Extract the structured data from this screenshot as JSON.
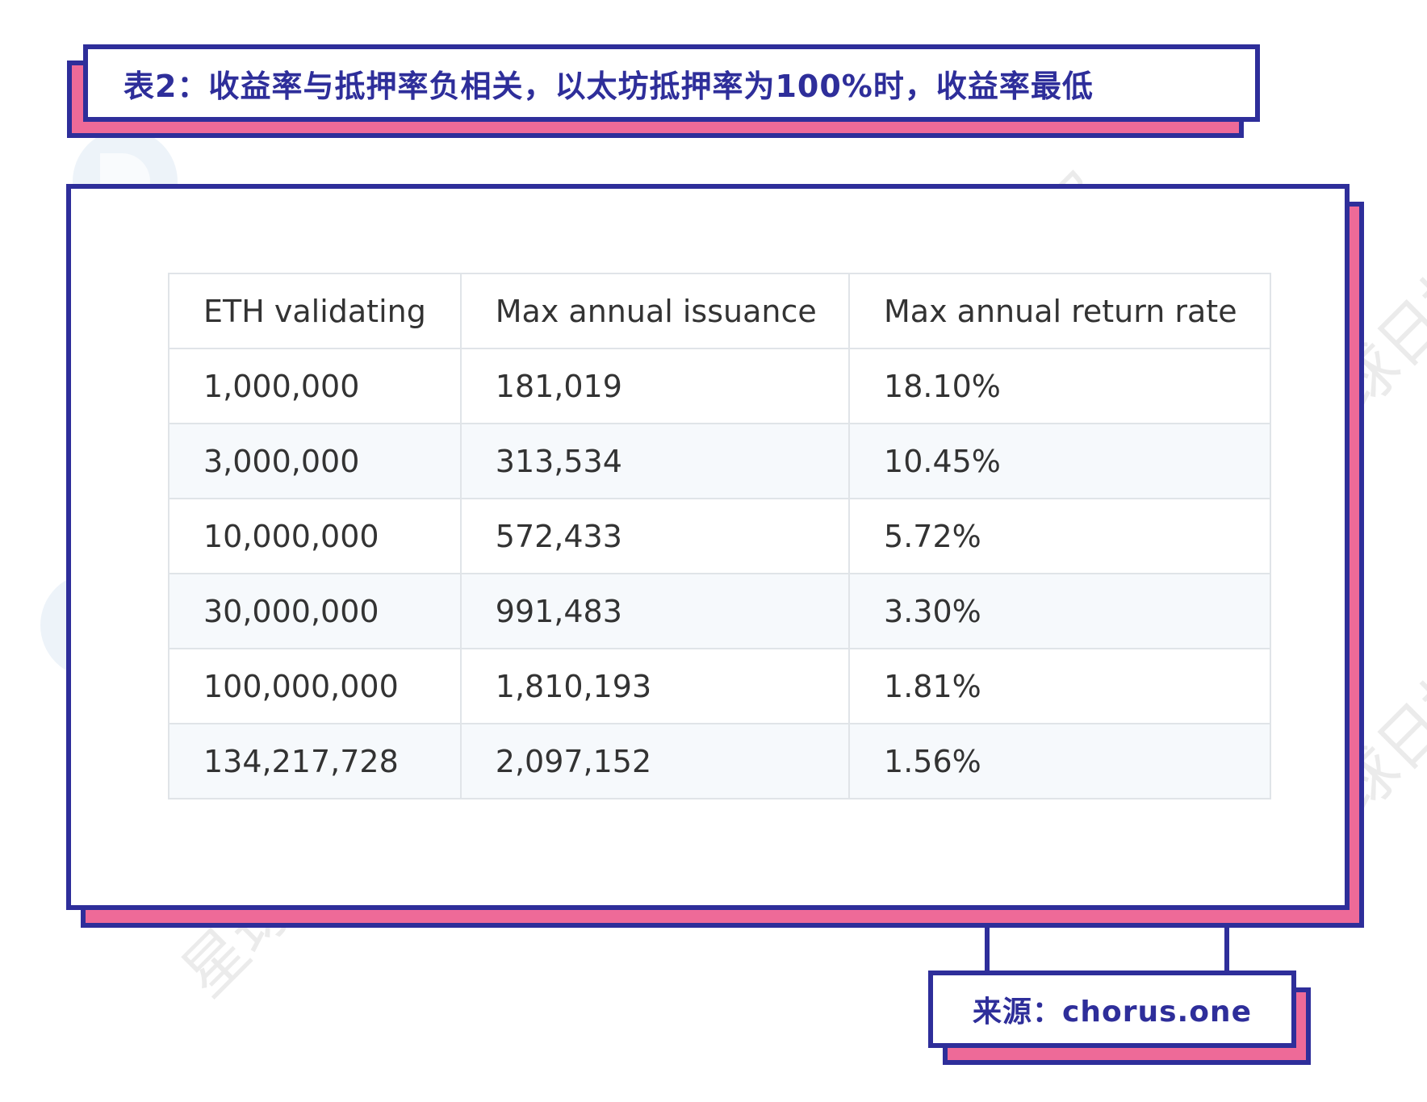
{
  "title": "表2：收益率与抵押率负相关，以太坊抵押率为100%时，收益率最低",
  "table": {
    "headers": [
      "ETH validating",
      "Max annual issuance",
      "Max annual return rate"
    ],
    "rows": [
      [
        "1,000,000",
        "181,019",
        "18.10%"
      ],
      [
        "3,000,000",
        "313,534",
        "10.45%"
      ],
      [
        "10,000,000",
        "572,433",
        "5.72%"
      ],
      [
        "30,000,000",
        "991,483",
        "3.30%"
      ],
      [
        "100,000,000",
        "1,810,193",
        "1.81%"
      ],
      [
        "134,217,728",
        "2,097,152",
        "1.56%"
      ]
    ]
  },
  "source": "来源：chorus.one",
  "watermark": {
    "text": "星球日报",
    "icon": "odaily-logo-icon"
  },
  "colors": {
    "navy": "#2e2e9a",
    "pink": "#ee6a98",
    "grid": "#e0e4e8",
    "stripe": "#f5f8fb"
  }
}
